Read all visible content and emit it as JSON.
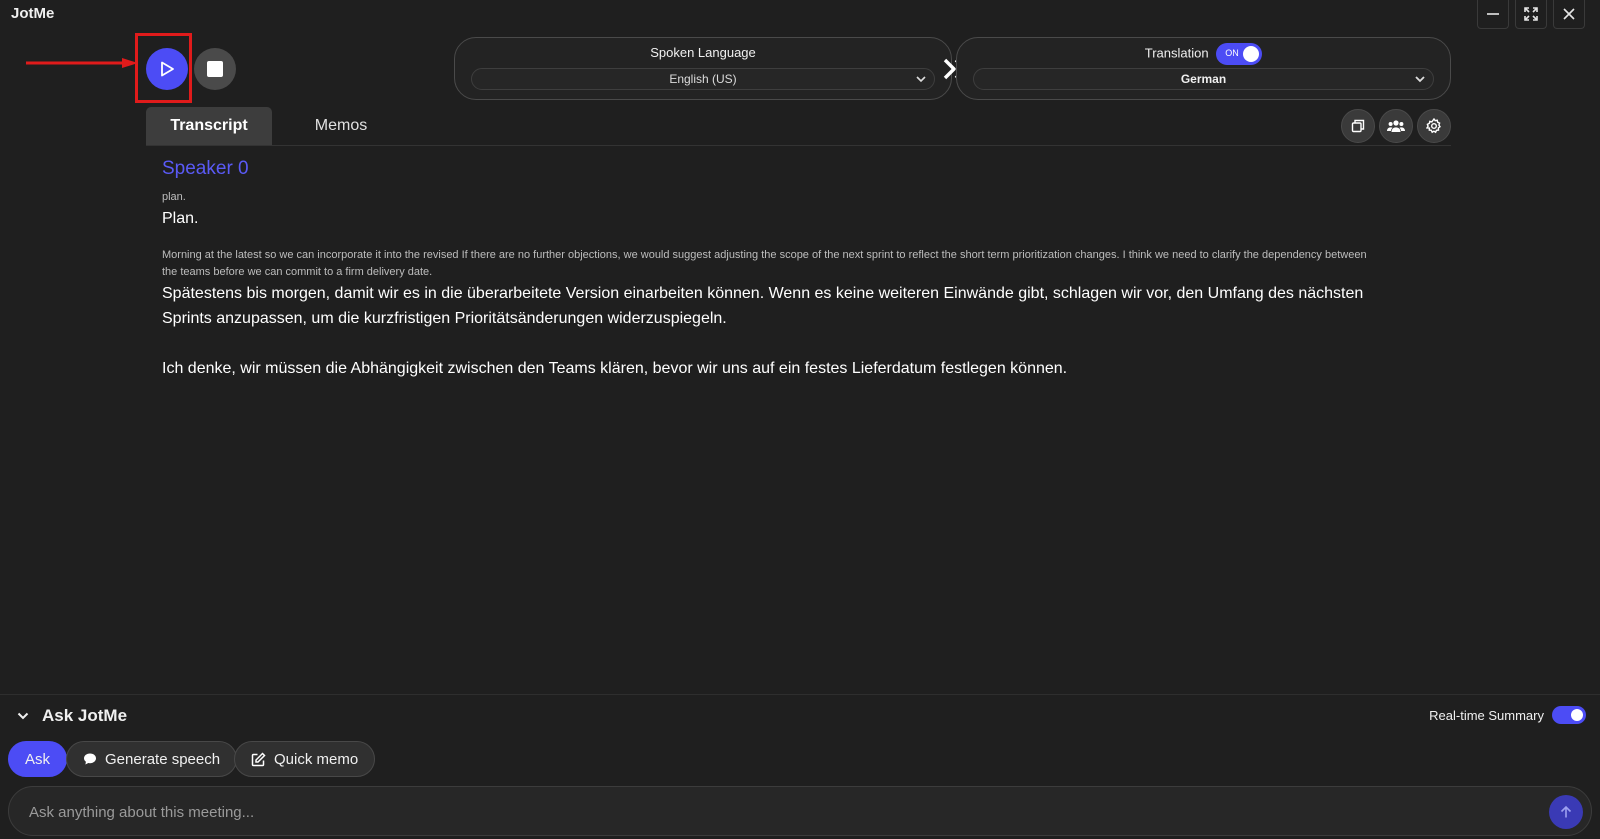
{
  "app": {
    "title": "JotMe"
  },
  "window": {
    "minimize_icon": "minimize-icon",
    "maximize_icon": "maximize-icon",
    "close_icon": "close-icon"
  },
  "controls": {
    "play_icon": "play-icon",
    "stop_icon": "stop-icon"
  },
  "spoken": {
    "label": "Spoken Language",
    "value": "English (US)"
  },
  "translation": {
    "label": "Translation",
    "toggle_text": "ON",
    "value": "German"
  },
  "tabs": [
    {
      "label": "Transcript",
      "active": true
    },
    {
      "label": "Memos",
      "active": false
    }
  ],
  "toolbar": {
    "icons": [
      "copy-icon",
      "people-icon",
      "settings-icon"
    ]
  },
  "transcript": {
    "speaker": "Speaker 0",
    "entries": [
      {
        "original": "plan.",
        "translation": "Plan."
      },
      {
        "original_lines": [
          "Morning at the latest so we can incorporate it into the revised If there are no further objections, we would suggest adjusting the scope of the next sprint to reflect the short term prioritization changes. I think we need to clarify the dependency between",
          "the teams before we can commit to a firm delivery date."
        ],
        "translation_lines": [
          "Spätestens bis morgen, damit wir es in die überarbeitete Version einarbeiten können. Wenn es keine weiteren Einwände gibt, schlagen wir vor, den Umfang des nächsten",
          "Sprints anzupassen, um die kurzfristigen Prioritätsänderungen widerzuspiegeln."
        ],
        "translation_extra": "Ich denke, wir müssen die Abhängigkeit zwischen den Teams klären, bevor wir uns auf ein festes Lieferdatum festlegen können."
      }
    ]
  },
  "ask": {
    "title": "Ask JotMe",
    "realtime_summary_label": "Real-time Summary",
    "realtime_summary_on": true,
    "buttons": {
      "ask": "Ask",
      "generate_speech": "Generate speech",
      "quick_memo": "Quick memo"
    },
    "input_placeholder": "Ask anything about this meeting..."
  },
  "colors": {
    "accent": "#4c4cf5",
    "background": "#1f1f1f",
    "annotation": "#e01b1b"
  }
}
